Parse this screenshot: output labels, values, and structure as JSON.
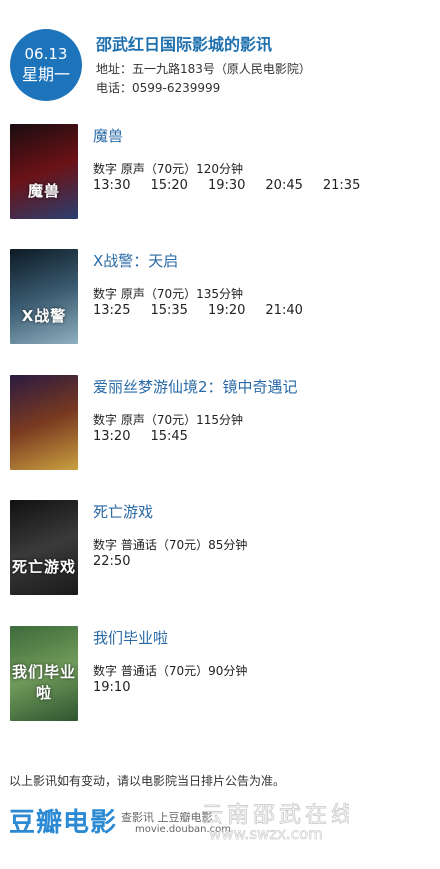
{
  "header": {
    "date": "06.13",
    "weekday": "星期一",
    "cinema_title": "邵武红日国际影城的影讯",
    "address": "地址：五一九路183号（原人民电影院）",
    "phone": "电话：0599-6239999"
  },
  "movies": [
    {
      "title": "魔兽",
      "info": "数字 原声（70元）120分钟",
      "times": [
        "13:30",
        "15:20",
        "19:30",
        "20:45",
        "21:35"
      ],
      "poster_text": "魔兽",
      "poster_colors": [
        "#1a0c10",
        "#6b1216",
        "#2a3f70"
      ]
    },
    {
      "title": "X战警：天启",
      "info": "数字 原声（70元）135分钟",
      "times": [
        "13:25",
        "15:35",
        "19:20",
        "21:40"
      ],
      "poster_text": "X战警",
      "poster_colors": [
        "#0c1a24",
        "#3a5a70",
        "#8fb0c0"
      ]
    },
    {
      "title": "爱丽丝梦游仙境2：镜中奇遇记",
      "info": "数字 原声（70元）115分钟",
      "times": [
        "13:20",
        "15:45"
      ],
      "poster_text": "",
      "poster_colors": [
        "#2a1a40",
        "#7a3a20",
        "#c9a040"
      ]
    },
    {
      "title": "死亡游戏",
      "info": "数字 普通话（70元）85分钟",
      "times": [
        "22:50"
      ],
      "poster_text": "死亡游戏",
      "poster_colors": [
        "#111111",
        "#3a3a3a",
        "#1a1a1a"
      ]
    },
    {
      "title": "我们毕业啦",
      "info": "数字 普通话（70元）90分钟",
      "times": [
        "19:10"
      ],
      "poster_text": "我们毕业啦",
      "poster_colors": [
        "#3d6a3a",
        "#6f9a5a",
        "#2f5530"
      ]
    }
  ],
  "notice": "以上影讯如有变动，请以电影院当日排片公告为准。",
  "footer": {
    "logo": "豆瓣电影",
    "sub1": "查影讯  上豆瓣电影",
    "sub2": "movie.douban.com",
    "watermark": "云南邵武在线",
    "watermark_url": "www.swzx.com"
  },
  "colors": {
    "accent": "#1d74ba",
    "title": "#1d6fae",
    "movie_title": "#2a6aa5",
    "douban": "#2b8ad3"
  }
}
